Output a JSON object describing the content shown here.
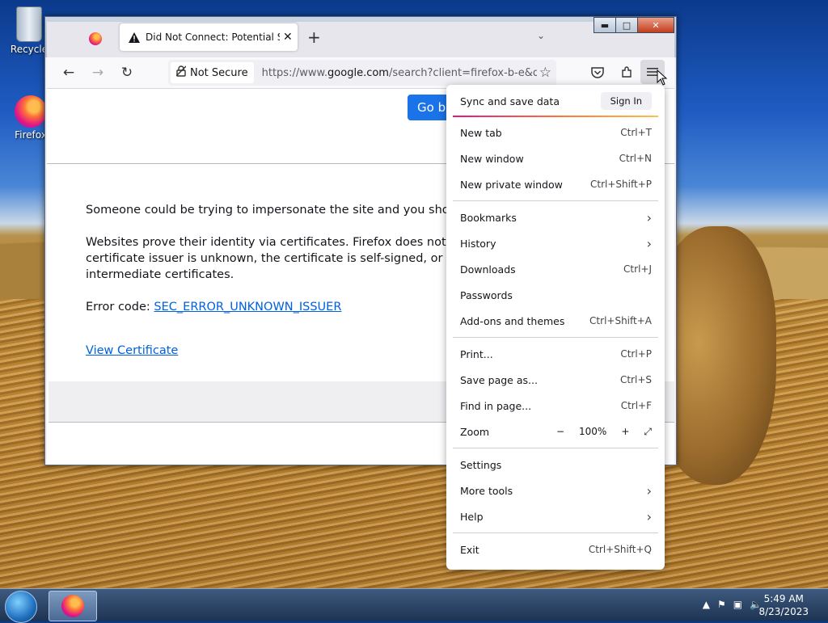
{
  "desktop": {
    "icons": [
      {
        "label": "Recycle",
        "icon": "recycle-bin-icon"
      },
      {
        "label": "Firefox",
        "icon": "firefox-icon"
      }
    ]
  },
  "window": {
    "caption_buttons": {
      "minimize": "▬",
      "maximize": "□",
      "close": "✕"
    },
    "tabs": [
      {
        "title": "Did Not Connect: Potential Security Issue",
        "active": true,
        "icon": "warning-icon"
      }
    ],
    "new_tab_symbol": "+",
    "tab_list_symbol": "⌄",
    "nav": {
      "back": "←",
      "forward": "→",
      "reload": "↻",
      "security_label": "Not Secure",
      "url_prefix": "https://www.",
      "url_host": "google.com",
      "url_rest": "/search?client=firefox-b-e&q=m"
    },
    "toolbar_icons": [
      "bookmark-star-icon",
      "pocket-icon",
      "extensions-icon",
      "menu-icon"
    ]
  },
  "page": {
    "go_button": "Go b",
    "para1": "Someone could be trying to impersonate the site and you should not",
    "para2_line1": "Websites prove their identity via certificates. Firefox does not trust w",
    "para2_line2": "certificate issuer is unknown, the certificate is self-signed, or the serv",
    "para2_line3": "intermediate certificates.",
    "error_code_label": "Error code: ",
    "error_code": "SEC_ERROR_UNKNOWN_ISSUER",
    "view_certificate": "View Certificate"
  },
  "app_menu": {
    "sync_label": "Sync and save data",
    "sign_in": "Sign In",
    "new_tab": {
      "label": "New tab",
      "shortcut": "Ctrl+T"
    },
    "new_window": {
      "label": "New window",
      "shortcut": "Ctrl+N"
    },
    "new_private_window": {
      "label": "New private window",
      "shortcut": "Ctrl+Shift+P"
    },
    "bookmarks": {
      "label": "Bookmarks"
    },
    "history": {
      "label": "History"
    },
    "downloads": {
      "label": "Downloads",
      "shortcut": "Ctrl+J"
    },
    "passwords": {
      "label": "Passwords"
    },
    "addons": {
      "label": "Add-ons and themes",
      "shortcut": "Ctrl+Shift+A"
    },
    "print": {
      "label": "Print...",
      "shortcut": "Ctrl+P"
    },
    "save_page": {
      "label": "Save page as...",
      "shortcut": "Ctrl+S"
    },
    "find": {
      "label": "Find in page...",
      "shortcut": "Ctrl+F"
    },
    "zoom": {
      "label": "Zoom",
      "minus": "−",
      "value": "100%",
      "plus": "+",
      "fullscreen": "⤢"
    },
    "settings": {
      "label": "Settings"
    },
    "more_tools": {
      "label": "More tools"
    },
    "help": {
      "label": "Help"
    },
    "exit": {
      "label": "Exit",
      "shortcut": "Ctrl+Shift+Q"
    }
  },
  "taskbar": {
    "time": "5:49 AM",
    "date": "8/23/2023",
    "tray_icons": [
      "show-hidden-icons-icon",
      "action-center-flag-icon",
      "network-icon",
      "volume-icon"
    ]
  }
}
